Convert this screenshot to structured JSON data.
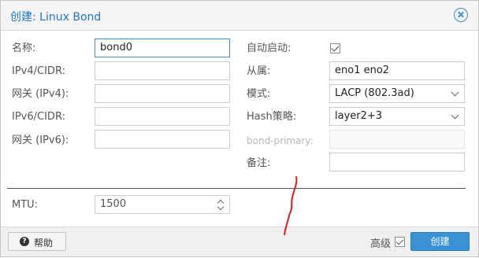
{
  "dialog": {
    "title": "创建: Linux Bond",
    "close_icon": "close-circle-icon",
    "accent_color": "#1e78c8"
  },
  "left_fields": {
    "name_label": "名称:",
    "name_value": "bond0",
    "ipv4_cidr_label": "IPv4/CIDR:",
    "ipv4_cidr_value": "",
    "gateway_ipv4_label": "网关 (IPv4):",
    "gateway_ipv4_value": "",
    "ipv6_cidr_label": "IPv6/CIDR:",
    "ipv6_cidr_value": "",
    "gateway_ipv6_label": "网关 (IPv6):",
    "gateway_ipv6_value": ""
  },
  "right_fields": {
    "autostart_label": "自动启动:",
    "autostart_checked": true,
    "slaves_label": "从属:",
    "slaves_value": "eno1 eno2",
    "mode_label": "模式:",
    "mode_value": "LACP (802.3ad)",
    "hash_policy_label": "Hash策略:",
    "hash_policy_value": "layer2+3",
    "bond_primary_label": "bond-primary:",
    "bond_primary_value": "",
    "comment_label": "备注:",
    "comment_value": ""
  },
  "mtu": {
    "label": "MTU:",
    "value": "1500"
  },
  "footer": {
    "help_icon": "question-circle-icon",
    "help_label": "帮助",
    "advanced_label": "高级",
    "advanced_checked": true,
    "create_label": "创建",
    "create_color": "#3892d4"
  },
  "annotation_color": "#e0191e"
}
